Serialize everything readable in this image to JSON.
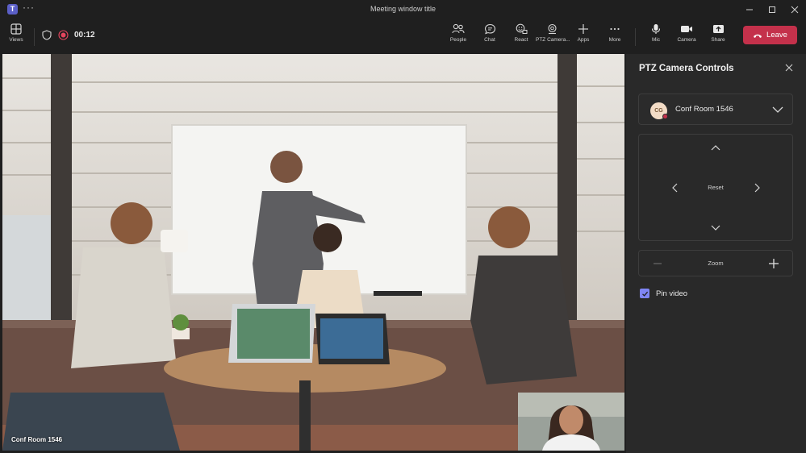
{
  "window": {
    "title": "Meeting window title",
    "app_icon_letter": "T",
    "more_glyph": "···"
  },
  "toolbar": {
    "views_label": "Views",
    "timer": "00:12",
    "people_label": "People",
    "chat_label": "Chat",
    "react_label": "React",
    "ptz_label": "PTZ Camera...",
    "apps_label": "Apps",
    "more_label": "More",
    "mic_label": "Mic",
    "camera_label": "Camera",
    "share_label": "Share",
    "leave_label": "Leave"
  },
  "stage": {
    "room_label": "Conf Room 1546"
  },
  "panel": {
    "title": "PTZ Camera Controls",
    "room_select": {
      "initials": "CG",
      "name": "Conf Room 1546"
    },
    "reset_label": "Reset",
    "zoom_label": "Zoom",
    "pin_video_label": "Pin video",
    "pin_video_checked": true
  },
  "colors": {
    "leave": "#c4314b",
    "accent": "#7f85f5",
    "recording": "#e5455e",
    "app_icon": "#5b5fc7"
  }
}
